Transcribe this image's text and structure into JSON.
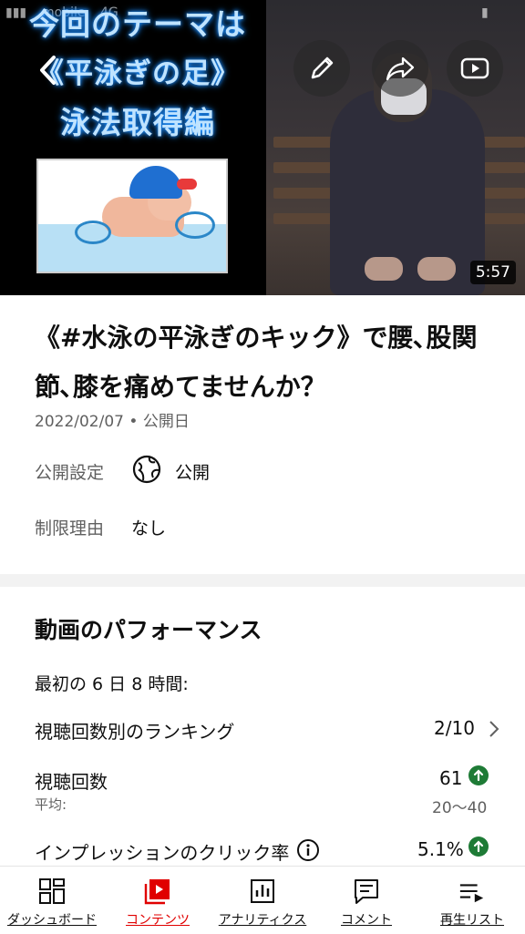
{
  "status_bar": {
    "carrier": "mobile",
    "network": "4G"
  },
  "video": {
    "overlay_lines": [
      "今回のテーマは",
      "《平泳ぎの足》",
      "泳法取得編"
    ],
    "duration": "5:57",
    "buttons": {
      "back": "back-icon",
      "edit": "pencil-icon",
      "share": "share-icon",
      "youtube": "youtube-icon"
    }
  },
  "details": {
    "title": "《#水泳の平泳ぎのキック》で腰､股関節､膝を痛めてませんか？",
    "date": "2022/02/07",
    "date_suffix": "公開日",
    "visibility_label": "公開設定",
    "visibility_value": "公開",
    "restriction_label": "制限理由",
    "restriction_value": "なし"
  },
  "performance": {
    "title": "動画のパフォーマンス",
    "period": "最初の 6 日 8 時間:",
    "ranking_label": "視聴回数別のランキング",
    "ranking_value": "2/10",
    "views_label": "視聴回数",
    "views_value": "61",
    "avg_label": "平均:",
    "avg_value": "20～40",
    "ctr_label": "インプレッションのクリック率",
    "ctr_value": "5.1%",
    "accent_up": "#1e7b36"
  },
  "bottom_nav": [
    {
      "label": "ダッシュボード",
      "icon": "dashboard-icon"
    },
    {
      "label": "コンテンツ",
      "icon": "content-icon",
      "active": true,
      "color": "#e00000"
    },
    {
      "label": "アナリティクス",
      "icon": "analytics-icon"
    },
    {
      "label": "コメント",
      "icon": "comment-icon"
    },
    {
      "label": "再生リスト",
      "icon": "playlist-icon"
    }
  ]
}
